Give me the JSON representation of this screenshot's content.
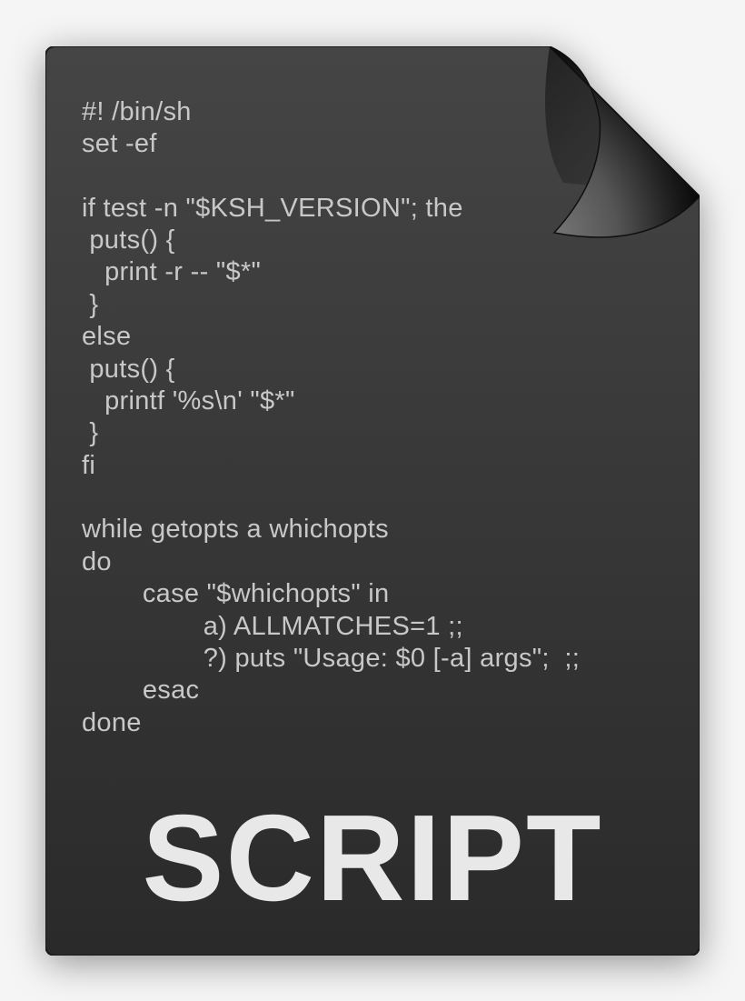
{
  "code": {
    "l01": "#! /bin/sh",
    "l02": "set -ef",
    "l03": "",
    "l04": "if test -n \"$KSH_VERSION\"; the",
    "l05": " puts() {",
    "l06": "   print -r -- \"$*\"",
    "l07": " }",
    "l08": "else",
    "l09": " puts() {",
    "l10": "   printf '%s\\n' \"$*\"",
    "l11": " }",
    "l12": "fi",
    "l13": "",
    "l14": "while getopts a whichopts",
    "l15": "do",
    "l16": "        case \"$whichopts\" in",
    "l17": "                a) ALLMATCHES=1 ;;",
    "l18": "                ?) puts \"Usage: $0 [-a] args\";  ;;",
    "l19": "        esac",
    "l20": "done"
  },
  "label": "SCRIPT"
}
